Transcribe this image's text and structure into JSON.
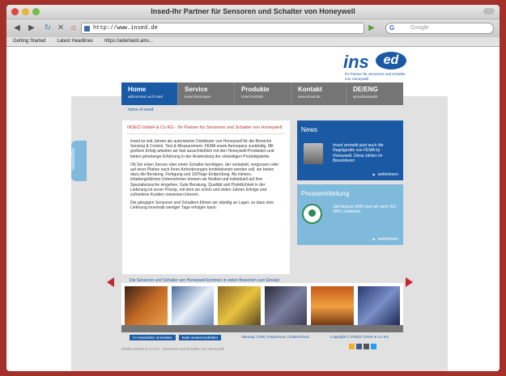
{
  "browser": {
    "window_title": "Insed-Ihr Partner für Sensoren und Schalter von Honeywell",
    "url": "http://www.insed.de",
    "search_placeholder": "Google",
    "bookmarks": [
      "Getting Started",
      "Latest Headlines",
      "https://aderilanti.ams..."
    ]
  },
  "logo": {
    "text": "ins",
    "oval_text": "ed",
    "tagline": "Ihr Partner für Sensoren und Schalter von Honeywell"
  },
  "nav": [
    {
      "title": "Home",
      "subtitle": "willkommen auf insed",
      "active": true
    },
    {
      "title": "Service",
      "subtitle": "insed leistungen",
      "active": false
    },
    {
      "title": "Produkte",
      "subtitle": "insed vertrieb",
      "active": false
    },
    {
      "title": "Kontakt",
      "subtitle": "www.insed.de",
      "active": false
    },
    {
      "title": "DE/ENG",
      "subtitle": "sprachauswahl",
      "active": false
    }
  ],
  "breadcrumb": "home of insed",
  "side_tab": "newsletter",
  "main": {
    "heading": "INSED GmbH & Co KG - Ihr Partner für Sensoren und Schalter von Honeywell",
    "paragraphs": [
      "insed ist seit Jahren als autorisierter Distributor von Honeywell für die Bereiche Sensing & Control, Test & Measurement, FEMA sowie Aerospace zuständig. Mit großem Erfolg arbeiten wir fast ausschließlich mit den Honeywell-Produkten und bieten jahrelange Erfahrung in der Anwendung der vielseitigen Produktpalette.",
      "Ob Sie einen Sensor oder einen Schalter benötigen, der verkabelt, vergossen oder auf einer Platine nach Ihren Anforderungen konfektioniert werden soll, wir bieten dazu die Beratung, Fertigung und 100%ige Endprüfung. Als kleines, inhabergeführtes Unternehmen können wir flexibel und individuell auf Ihre Spezialwünsche eingehen. Gute Beratung, Qualität und Pünktlichkeit in der Lieferung ist unser Prinzip, mit dem wir schon seit vielen Jahren Erfolge und zufriedene Kunden vorweisen können.",
      "Die gängigen Sensoren und Schaltern führen wir ständig an Lager, so dass eine Lieferung innerhalb weniger Tage erfolgen kann."
    ]
  },
  "news": {
    "title": "News",
    "text": "Insed vertreibt jetzt auch die Regelgeräte von FEMA by Honeywell. Diese zählen im Besonderen",
    "more": "weiterlesen"
  },
  "press": {
    "title": "Pressemitteilung",
    "text": "Seit August 2009 sind wir nach ISO 9001 zertifiziert.",
    "more": "weiterlesen"
  },
  "gallery": {
    "caption": "Die Sensoren und Schalter von Honeywell kommen in vielen Branchen zum Einsatz"
  },
  "footer": {
    "buttons": [
      "Im Newsletter anmelden",
      "Seite weiterempfehlen"
    ],
    "links_center": "Sitemap | AGB | Impressum | Datenschutz",
    "links_right": "Copyright © INSED GmbH & Co KG",
    "copyright": "INSED GmbH & Co KG · Sensoren und Schalter von Honeywell"
  },
  "colors": {
    "brand_blue": "#1a5aa5",
    "light_blue": "#7fb9dc",
    "nav_gray": "#757575",
    "accent_red": "#c1272d",
    "background": "#a3302a"
  }
}
